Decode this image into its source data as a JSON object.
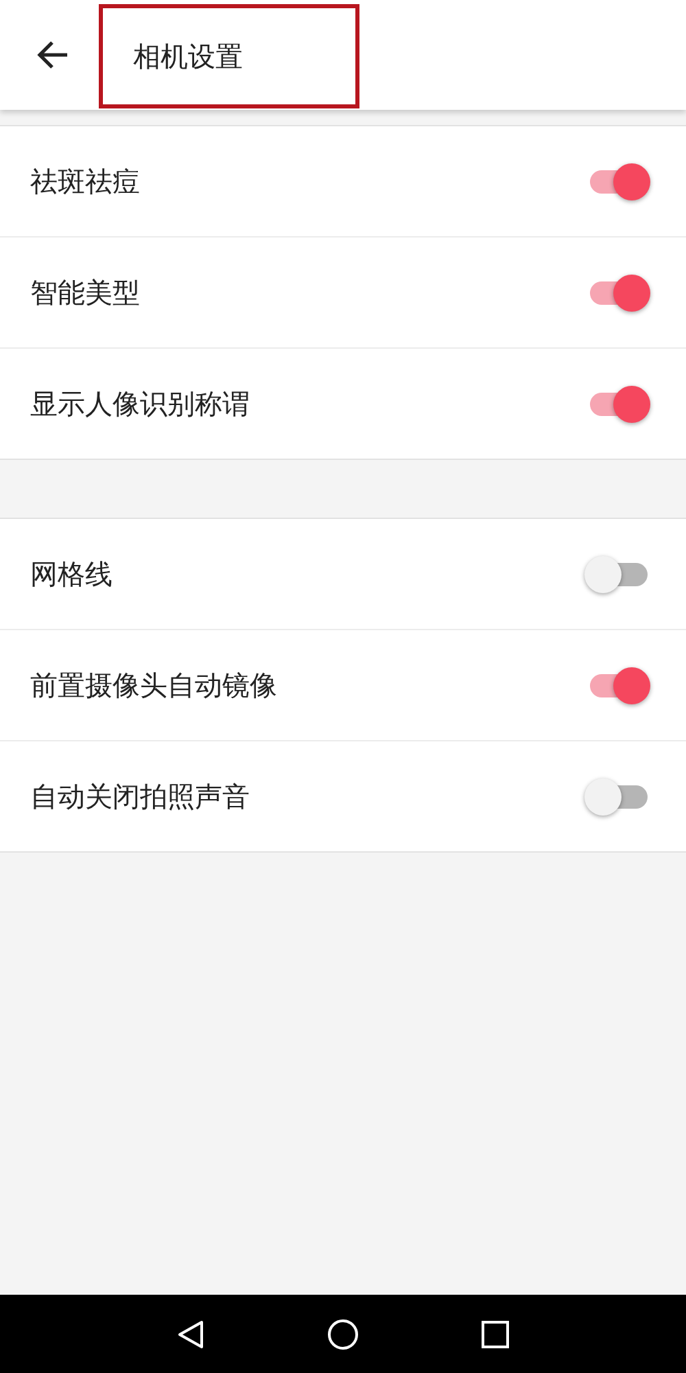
{
  "header": {
    "title": "相机设置",
    "highlighted": true
  },
  "sections": [
    {
      "items": [
        {
          "label": "祛斑祛痘",
          "on": true
        },
        {
          "label": "智能美型",
          "on": true
        },
        {
          "label": "显示人像识别称谓",
          "on": true
        }
      ]
    },
    {
      "items": [
        {
          "label": "网格线",
          "on": false
        },
        {
          "label": "前置摄像头自动镜像",
          "on": true
        },
        {
          "label": "自动关闭拍照声音",
          "on": false
        }
      ]
    }
  ]
}
